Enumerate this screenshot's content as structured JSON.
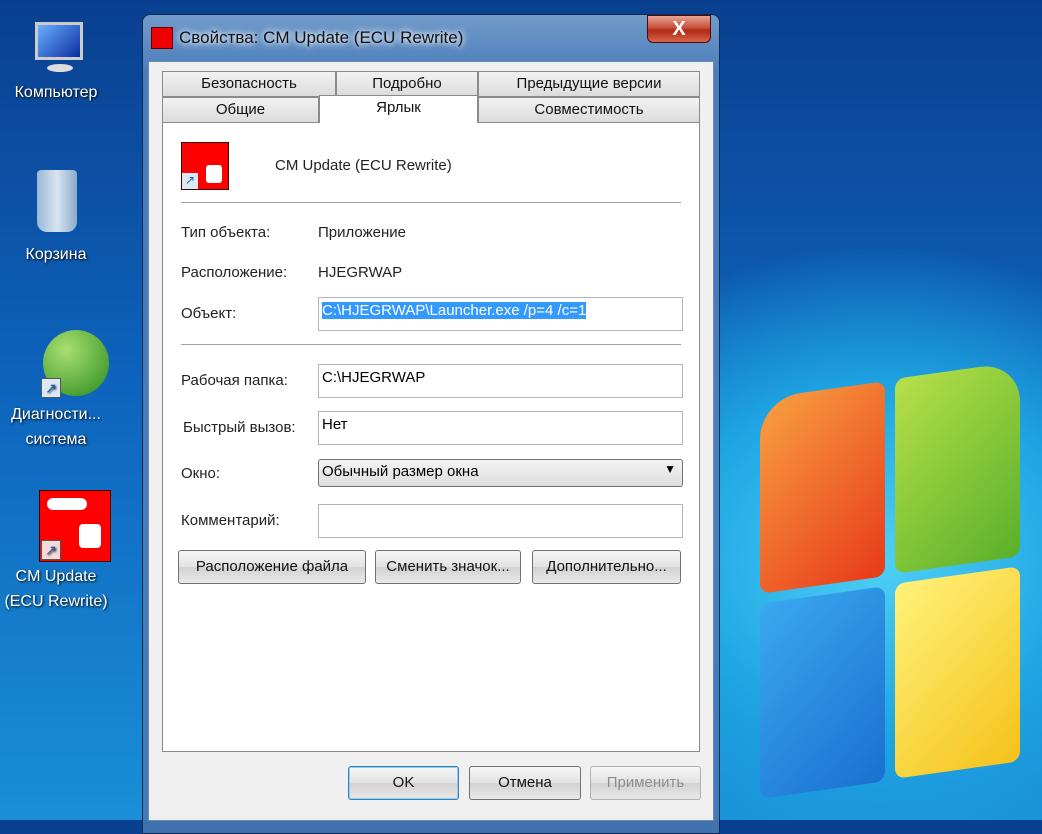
{
  "desktop": {
    "icons": [
      {
        "label": "Компьютер"
      },
      {
        "label": "Корзина"
      },
      {
        "label": "Диагности...",
        "label2": "система"
      },
      {
        "label": "CM Update",
        "label2": "(ECU Rewrite)"
      }
    ]
  },
  "dialog": {
    "title": "Свойства: CM Update (ECU Rewrite)",
    "close_label": "X",
    "tabs_row1": [
      "Безопасность",
      "Подробно",
      "Предыдущие версии"
    ],
    "tabs_row2": [
      "Общие",
      "Ярлык",
      "Совместимость"
    ],
    "active_tab": "Ярлык",
    "app_name": "CM Update (ECU Rewrite)",
    "type_label": "Тип объекта:",
    "type_value": "Приложение",
    "location_label": "Расположение:",
    "location_value": "HJEGRWAP",
    "target_label": "Объект:",
    "target_value": "C:\\HJEGRWAP\\Launcher.exe /p=4 /c=1",
    "workdir_label": "Рабочая папка:",
    "workdir_value": "C:\\HJEGRWAP",
    "hotkey_label": "Быстрый вызов:",
    "hotkey_value": "Нет",
    "window_label": "Окно:",
    "window_value": "Обычный размер окна",
    "comment_label": "Комментарий:",
    "comment_value": "",
    "buttons": {
      "file_location": "Расположение файла",
      "change_icon": "Сменить значок...",
      "advanced": "Дополнительно...",
      "ok": "OK",
      "cancel": "Отмена",
      "apply": "Применить"
    }
  }
}
